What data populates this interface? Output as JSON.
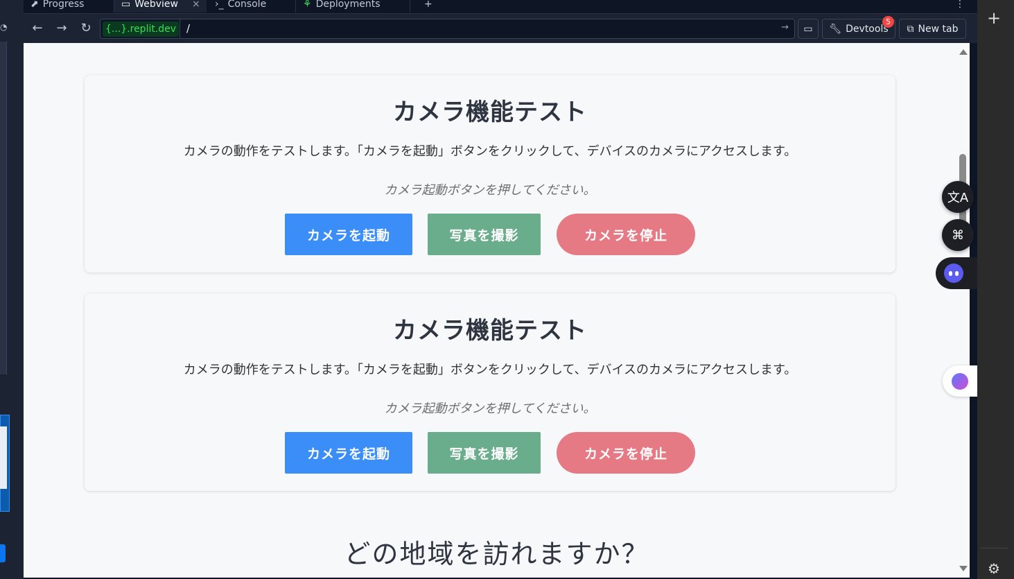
{
  "tabs": [
    {
      "label": "Progress",
      "icon": "progress-icon"
    },
    {
      "label": "Webview",
      "icon": "monitor-icon",
      "active": true
    },
    {
      "label": "Console",
      "icon": "terminal-icon"
    },
    {
      "label": "Deployments",
      "icon": "deploy-icon"
    }
  ],
  "urlbar": {
    "host": "{...}.replit.dev",
    "path": "/"
  },
  "toolbar": {
    "devtools_label": "Devtools",
    "devtools_badge": "5",
    "newtab_label": "New tab"
  },
  "cards": [
    {
      "title": "カメラ機能テスト",
      "description": "カメラの動作をテストします。「カメラを起動」ボタンをクリックして、デバイスのカメラにアクセスします。",
      "status": "カメラ起動ボタンを押してください。",
      "start_label": "カメラを起動",
      "photo_label": "写真を撮影",
      "stop_label": "カメラを停止"
    },
    {
      "title": "カメラ機能テスト",
      "description": "カメラの動作をテストします。「カメラを起動」ボタンをクリックして、デバイスのカメラにアクセスします。",
      "status": "カメラ起動ボタンを押してください。",
      "start_label": "カメラを起動",
      "photo_label": "写真を撮影",
      "stop_label": "カメラを停止"
    }
  ],
  "question": "どの地域を訪れますか？",
  "colors": {
    "start_button": "#3b8ef7",
    "photo_button": "#6aad8c",
    "stop_button": "#e67a84",
    "url_host": "#3ddc5a",
    "badge": "#f44545"
  }
}
